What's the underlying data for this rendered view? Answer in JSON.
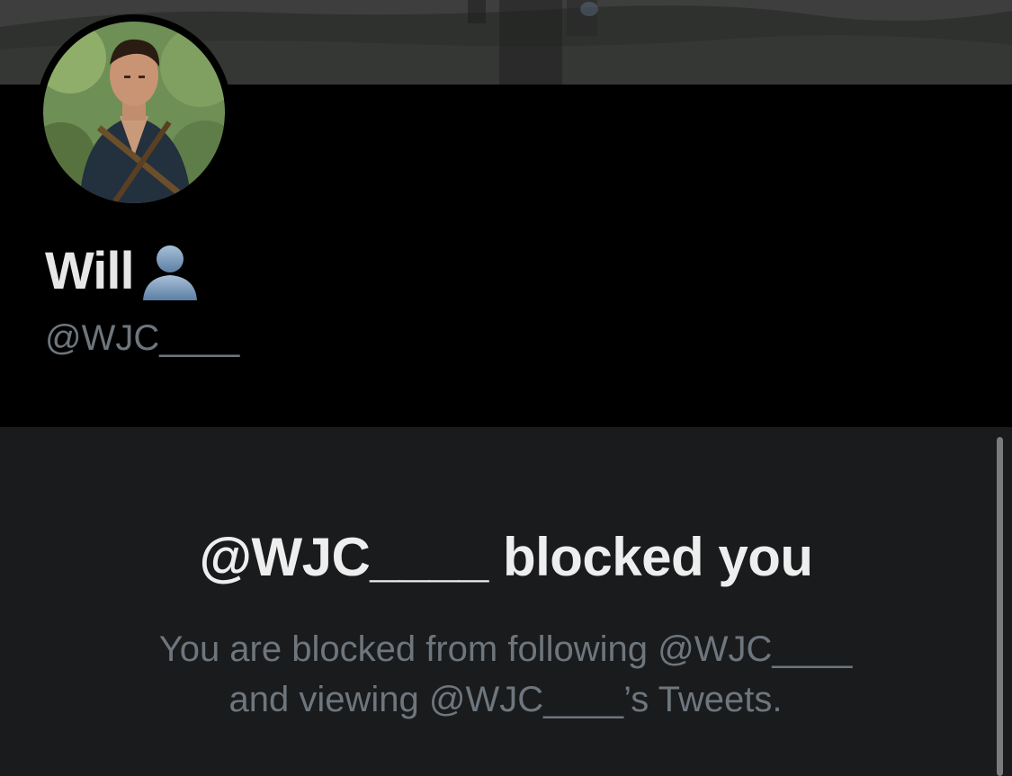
{
  "profile": {
    "display_name": "Will",
    "name_icon": "bust-in-silhouette-icon",
    "handle": "@WJC____"
  },
  "blocked": {
    "title": "@WJC____ blocked you",
    "description_line1": "You are blocked from following @WJC____",
    "description_line2": "and viewing @WJC____’s Tweets."
  },
  "colors": {
    "background": "#000000",
    "panel": "#1a1b1d",
    "primary_text": "#e6e6e6",
    "secondary_text": "#6e767d"
  }
}
